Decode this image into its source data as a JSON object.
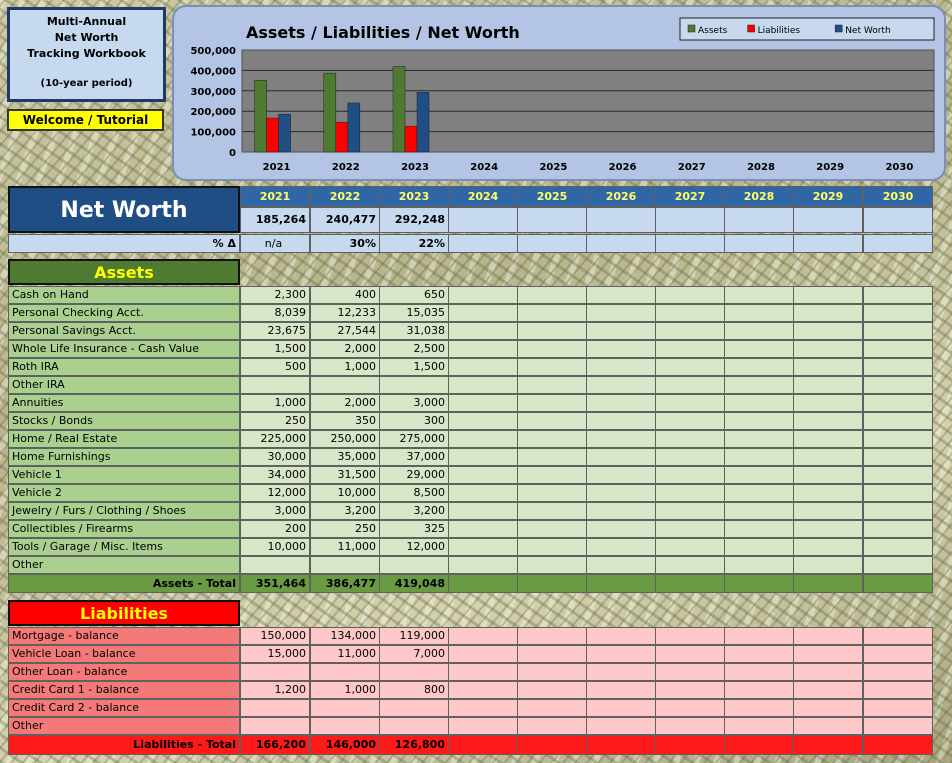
{
  "title_box": {
    "line1": "Multi-Annual",
    "line2": "Net Worth",
    "line3": "Tracking Workbook",
    "line4": "(10-year period)"
  },
  "welcome_button": "Welcome / Tutorial",
  "years": [
    "2021",
    "2022",
    "2023",
    "2024",
    "2025",
    "2026",
    "2027",
    "2028",
    "2029",
    "2030"
  ],
  "net_worth": {
    "label": "Net Worth",
    "values": [
      "185,264",
      "240,477",
      "292,248",
      "",
      "",
      "",
      "",
      "",
      "",
      ""
    ],
    "pct_label": "% Δ",
    "pct": [
      "n/a",
      "30%",
      "22%",
      "",
      "",
      "",
      "",
      "",
      "",
      ""
    ]
  },
  "assets": {
    "label": "Assets",
    "rows": [
      {
        "label": "Cash on Hand",
        "values": [
          "2,300",
          "400",
          "650"
        ]
      },
      {
        "label": "Personal Checking Acct.",
        "values": [
          "8,039",
          "12,233",
          "15,035"
        ]
      },
      {
        "label": "Personal Savings Acct.",
        "values": [
          "23,675",
          "27,544",
          "31,038"
        ]
      },
      {
        "label": "Whole Life Insurance - Cash Value",
        "values": [
          "1,500",
          "2,000",
          "2,500"
        ]
      },
      {
        "label": "Roth IRA",
        "values": [
          "500",
          "1,000",
          "1,500"
        ]
      },
      {
        "label": "Other IRA",
        "values": [
          "",
          "",
          ""
        ]
      },
      {
        "label": "Annuities",
        "values": [
          "1,000",
          "2,000",
          "3,000"
        ]
      },
      {
        "label": "Stocks / Bonds",
        "values": [
          "250",
          "350",
          "300"
        ]
      },
      {
        "label": "Home / Real Estate",
        "values": [
          "225,000",
          "250,000",
          "275,000"
        ]
      },
      {
        "label": "Home Furnishings",
        "values": [
          "30,000",
          "35,000",
          "37,000"
        ]
      },
      {
        "label": "Vehicle 1",
        "values": [
          "34,000",
          "31,500",
          "29,000"
        ]
      },
      {
        "label": "Vehicle 2",
        "values": [
          "12,000",
          "10,000",
          "8,500"
        ]
      },
      {
        "label": "Jewelry / Furs / Clothing / Shoes",
        "values": [
          "3,000",
          "3,200",
          "3,200"
        ]
      },
      {
        "label": "Collectibles / Firearms",
        "values": [
          "200",
          "250",
          "325"
        ]
      },
      {
        "label": "Tools / Garage / Misc. Items",
        "values": [
          "10,000",
          "11,000",
          "12,000"
        ]
      },
      {
        "label": "Other",
        "values": [
          "",
          "",
          ""
        ]
      }
    ],
    "total_label": "Assets - Total",
    "totals": [
      "351,464",
      "386,477",
      "419,048"
    ]
  },
  "liabilities": {
    "label": "Liabilities",
    "rows": [
      {
        "label": "Mortgage - balance",
        "values": [
          "150,000",
          "134,000",
          "119,000"
        ]
      },
      {
        "label": "Vehicle Loan - balance",
        "values": [
          "15,000",
          "11,000",
          "7,000"
        ]
      },
      {
        "label": "Other Loan - balance",
        "values": [
          "",
          "",
          ""
        ]
      },
      {
        "label": "Credit Card 1 - balance",
        "values": [
          "1,200",
          "1,000",
          "800"
        ]
      },
      {
        "label": "Credit Card 2 - balance",
        "values": [
          "",
          "",
          ""
        ]
      },
      {
        "label": "Other",
        "values": [
          "",
          "",
          ""
        ]
      }
    ],
    "total_label": "Liabilities - Total",
    "totals": [
      "166,200",
      "146,000",
      "126,800"
    ]
  },
  "chart_data": {
    "type": "bar",
    "title": "Assets / Liabilities / Net Worth",
    "categories": [
      "2021",
      "2022",
      "2023",
      "2024",
      "2025",
      "2026",
      "2027",
      "2028",
      "2029",
      "2030"
    ],
    "series": [
      {
        "name": "Assets",
        "color": "#4f7a32",
        "values": [
          351464,
          386477,
          419048,
          null,
          null,
          null,
          null,
          null,
          null,
          null
        ]
      },
      {
        "name": "Liabilities",
        "color": "#ff0000",
        "values": [
          166200,
          146000,
          126800,
          null,
          null,
          null,
          null,
          null,
          null,
          null
        ]
      },
      {
        "name": "Net Worth",
        "color": "#1f4e85",
        "values": [
          185264,
          240477,
          292248,
          null,
          null,
          null,
          null,
          null,
          null,
          null
        ]
      }
    ],
    "ylim": [
      0,
      500000
    ],
    "yticks": [
      "500,000",
      "400,000",
      "300,000",
      "200,000",
      "100,000",
      "0"
    ],
    "grid": true,
    "legend": "top-right"
  }
}
